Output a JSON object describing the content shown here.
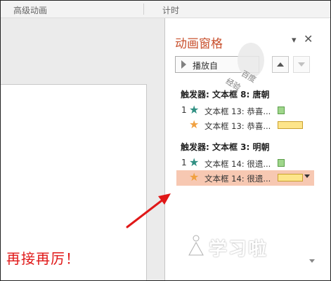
{
  "ribbon": {
    "group_advanced": "高级动画",
    "group_timing": "计时"
  },
  "slide": {
    "text": "再接再厉！"
  },
  "pane": {
    "title": "动画窗格",
    "play_button": "播放自",
    "dropdown_icon": "chevron-down-icon",
    "close_icon": "close-icon",
    "move_up_icon": "arrow-up-icon",
    "move_down_icon": "arrow-down-icon",
    "triggers": [
      {
        "label": "触发器: 文本框 8: 唐朝",
        "items": [
          {
            "order": "1",
            "effect_icon": "green-star-icon",
            "name": "文本框 13: 恭喜..."
          },
          {
            "order": "",
            "effect_icon": "orange-star-icon",
            "name": "文本框 13: 恭喜..."
          }
        ]
      },
      {
        "label": "触发器: 文本框 3: 明朝",
        "items": [
          {
            "order": "1",
            "effect_icon": "green-star-icon",
            "name": "文本框 14: 很遗..."
          },
          {
            "order": "",
            "effect_icon": "orange-star-icon",
            "name": "文本框 14: 很遗...",
            "selected": true
          }
        ]
      }
    ]
  },
  "watermark": {
    "top_text_1": "百度",
    "top_text_2": "经验",
    "bottom_text": "学习啦"
  },
  "colors": {
    "pane_title": "#c8502d",
    "slide_text": "#e01818",
    "selected_row": "#f7c8b2",
    "annotation_arrow": "#e01818"
  }
}
